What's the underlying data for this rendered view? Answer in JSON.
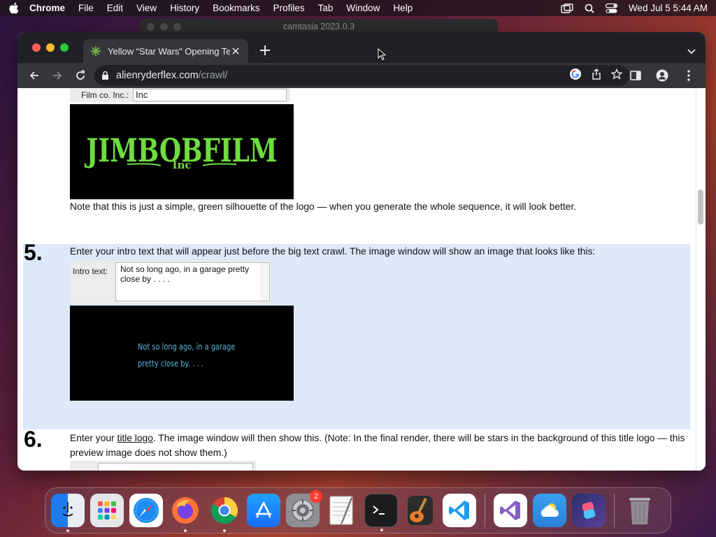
{
  "menubar": {
    "app_name": "Chrome",
    "items": [
      "File",
      "Edit",
      "View",
      "History",
      "Bookmarks",
      "Profiles",
      "Tab",
      "Window",
      "Help"
    ],
    "clock": "Wed Jul 5  5:44 AM"
  },
  "background_window": {
    "title": "camtasia 2023.0.3"
  },
  "browser": {
    "tab_title": "Yellow “Star Wars” Opening Te",
    "url_host": "alienryderflex.com",
    "url_path": "/crawl/"
  },
  "page": {
    "film_co_label": "Film co. Inc.:",
    "film_co_value": "Inc",
    "logo_text": "JIMBOBFILM",
    "logo_subtext": "Inc",
    "note_text": "Note that this is just a simple, green silhouette of the logo — when you generate the whole sequence, it will look better.",
    "step5": {
      "number": "5.",
      "text": "Enter your intro text that will appear just before the big text crawl. The image window will show an image that looks like this:",
      "intro_label": "Intro text:",
      "intro_value": "Not so long ago, in a garage pretty close by . . . .",
      "preview_line1": "Not so long ago, in a garage",
      "preview_line2": "pretty close by. . . ."
    },
    "step6": {
      "number": "6.",
      "text_before": "Enter your ",
      "link_text": "title logo",
      "text_after": ". The image window will then show this. (Note: In the final render, there will be stars in the background of this title logo — this preview image does not show them.)"
    }
  },
  "dock": {
    "apps": [
      "Finder",
      "Launchpad",
      "Safari",
      "Firefox",
      "Chrome",
      "App Store",
      "System Settings",
      "TextEdit",
      "Terminal",
      "GarageBand",
      "Visual Studio Code",
      "Visual Studio",
      "Weather",
      "Shortcuts",
      "Trash"
    ],
    "settings_badge": "2"
  },
  "colors": {
    "highlight_bg": "#dde9f8",
    "logo_green": "#6fdc3f",
    "intro_text_blue": "#5ab4d6",
    "chrome_dark": "#202124"
  }
}
